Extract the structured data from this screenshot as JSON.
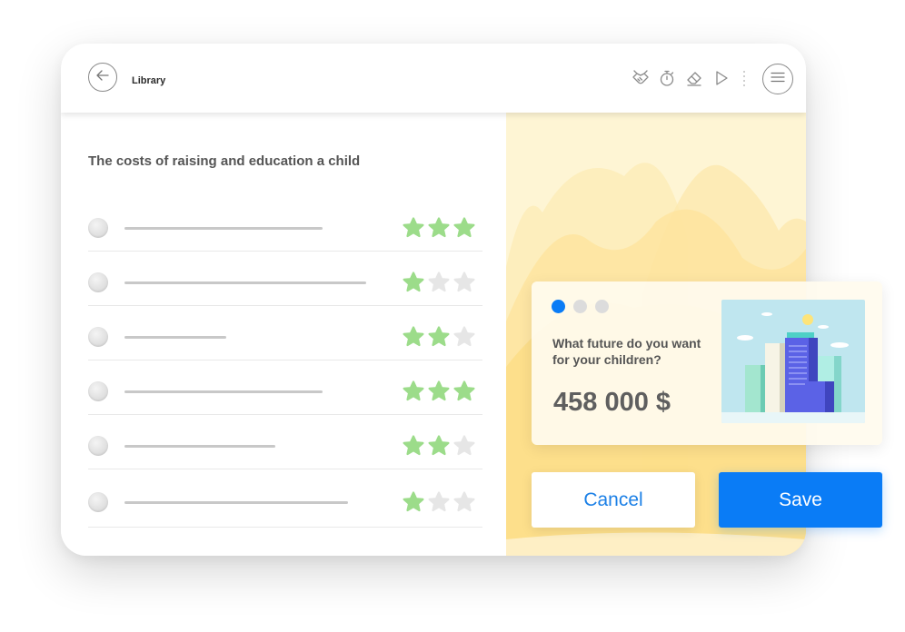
{
  "header": {
    "title": "Library",
    "back_icon": "arrow-left-icon",
    "tools": [
      "handshake-icon",
      "stopwatch-icon",
      "eraser-icon",
      "play-icon"
    ],
    "menu_icon": "hamburger-menu-icon"
  },
  "list": {
    "title": "The costs of raising and education a child",
    "items": [
      {
        "rating": 3
      },
      {
        "rating": 1
      },
      {
        "rating": 2
      },
      {
        "rating": 3
      },
      {
        "rating": 2
      },
      {
        "rating": 1
      }
    ],
    "max_rating": 3
  },
  "card": {
    "pager": {
      "count": 3,
      "active": 1
    },
    "question": "What future do you want for your children?",
    "amount": "458 000 $",
    "image": "city-buildings-illustration"
  },
  "actions": {
    "cancel_label": "Cancel",
    "save_label": "Save"
  },
  "colors": {
    "accent": "#0a7cf6",
    "star_on": "#9cdc8a",
    "star_off": "#e6e6e6",
    "panel_bg": "#fef5d4",
    "dot_inactive": "#dcdcdc"
  }
}
